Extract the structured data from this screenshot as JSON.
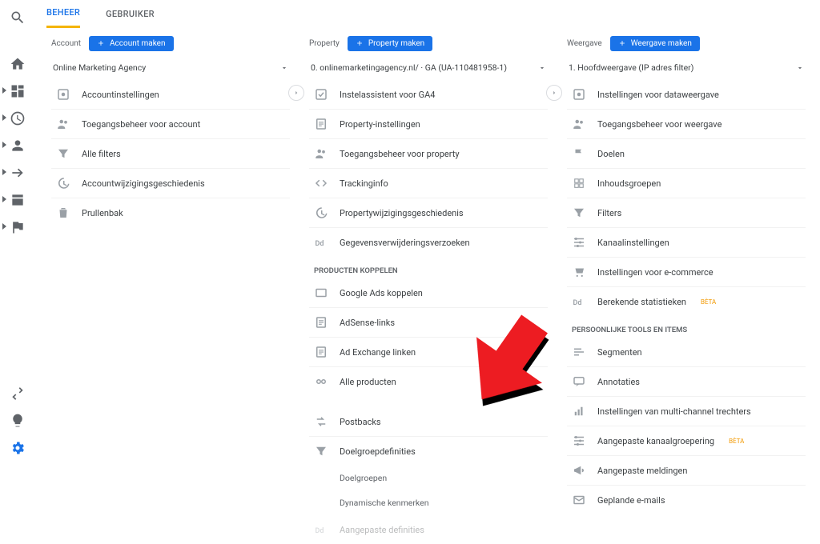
{
  "tabs": {
    "active": "BEHEER",
    "other": "GEBRUIKER"
  },
  "account": {
    "colname": "Account",
    "create": "Account maken",
    "dropdown": "Online Marketing Agency",
    "items": [
      {
        "icon": "settings-box",
        "label": "Accountinstellingen"
      },
      {
        "icon": "people",
        "label": "Toegangsbeheer voor account"
      },
      {
        "icon": "filter",
        "label": "Alle filters"
      },
      {
        "icon": "history",
        "label": "Accountwijzigingsgeschiedenis"
      },
      {
        "icon": "trash",
        "label": "Prullenbak"
      }
    ]
  },
  "property": {
    "colname": "Property",
    "create": "Property maken",
    "dropdown": "0. onlinemarketingagency.nl/ · GA (UA-110481958-1)",
    "items": [
      {
        "icon": "check-box",
        "label": "Instelassistent voor GA4"
      },
      {
        "icon": "page",
        "label": "Property-instellingen"
      },
      {
        "icon": "people",
        "label": "Toegangsbeheer voor property"
      },
      {
        "icon": "code",
        "label": "Trackinginfo"
      },
      {
        "icon": "history",
        "label": "Propertywijzigingsgeschiedenis"
      },
      {
        "icon": "dd",
        "label": "Gegevensverwijderingsverzoeken"
      }
    ],
    "sectionA": "PRODUCTEN KOPPELEN",
    "itemsA": [
      {
        "icon": "ads",
        "label": "Google Ads koppelen"
      },
      {
        "icon": "page",
        "label": "AdSense-links"
      },
      {
        "icon": "page",
        "label": "Ad Exchange linken"
      },
      {
        "icon": "link",
        "label": "Alle producten"
      }
    ],
    "itemsB": [
      {
        "icon": "postback",
        "label": "Postbacks"
      },
      {
        "icon": "filter",
        "label": "Doelgroepdefinities"
      }
    ],
    "subs": [
      "Doelgroepen",
      "Dynamische kenmerken"
    ],
    "itemsC": [
      {
        "icon": "dd",
        "label": "Aangepaste definities"
      }
    ]
  },
  "view": {
    "colname": "Weergave",
    "create": "Weergave maken",
    "dropdown": "1. Hoofdweergave (IP adres filter)",
    "items": [
      {
        "icon": "settings-box",
        "label": "Instellingen voor dataweergave"
      },
      {
        "icon": "people",
        "label": "Toegangsbeheer voor weergave"
      },
      {
        "icon": "flag",
        "label": "Doelen"
      },
      {
        "icon": "content",
        "label": "Inhoudsgroepen"
      },
      {
        "icon": "filter",
        "label": "Filters"
      },
      {
        "icon": "channel",
        "label": "Kanaalinstellingen"
      },
      {
        "icon": "cart",
        "label": "Instellingen voor e-commerce"
      },
      {
        "icon": "dd",
        "label": "Berekende statistieken",
        "beta": "BÈTA"
      }
    ],
    "sectionB": "PERSOONLIJKE TOOLS EN ITEMS",
    "itemsB": [
      {
        "icon": "segment",
        "label": "Segmenten"
      },
      {
        "icon": "annot",
        "label": "Annotaties"
      },
      {
        "icon": "funnel",
        "label": "Instellingen van multi-channel trechters"
      },
      {
        "icon": "channel",
        "label": "Aangepaste kanaalgroepering",
        "beta": "BÈTA"
      },
      {
        "icon": "bullhorn",
        "label": "Aangepaste meldingen"
      },
      {
        "icon": "mail",
        "label": "Geplande e-mails"
      }
    ]
  }
}
